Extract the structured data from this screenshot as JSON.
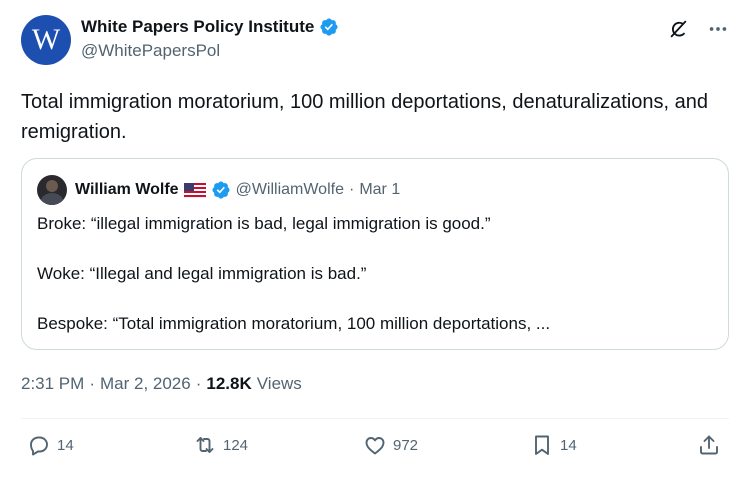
{
  "author": {
    "avatar_letter": "W",
    "name": "White Papers Policy Institute",
    "handle": "@WhitePapersPol"
  },
  "tweet": {
    "text": "Total immigration moratorium, 100 million deportations, denaturalizations, and remigration."
  },
  "quote": {
    "name": "William Wolfe",
    "handle": "@WilliamWolfe",
    "separator": "·",
    "date": "Mar 1",
    "lines": [
      "Broke: “illegal immigration is bad, legal immigration is good.”",
      "Woke: “Illegal and legal immigration is bad.”",
      "Bespoke: “Total immigration moratorium, 100 million deportations, ..."
    ]
  },
  "meta": {
    "time": "2:31 PM",
    "sep1": "·",
    "date": "Mar 2, 2026",
    "sep2": "·",
    "views_count": "12.8K",
    "views_label": "Views"
  },
  "actions": {
    "replies": "14",
    "reposts": "124",
    "likes": "972",
    "bookmarks": "14"
  },
  "colors": {
    "verified": "#1d9bf0",
    "secondary_text": "#536471",
    "primary_text": "#0f1419",
    "border": "#cfd9de",
    "avatar_bg": "#1d4fb0"
  },
  "icons": {
    "verified": "verified-badge-icon",
    "grok": "grok-icon",
    "more": "more-icon",
    "reply": "reply-icon",
    "repost": "repost-icon",
    "like": "heart-icon",
    "bookmark": "bookmark-icon",
    "share": "share-icon",
    "flag": "us-flag-icon"
  }
}
